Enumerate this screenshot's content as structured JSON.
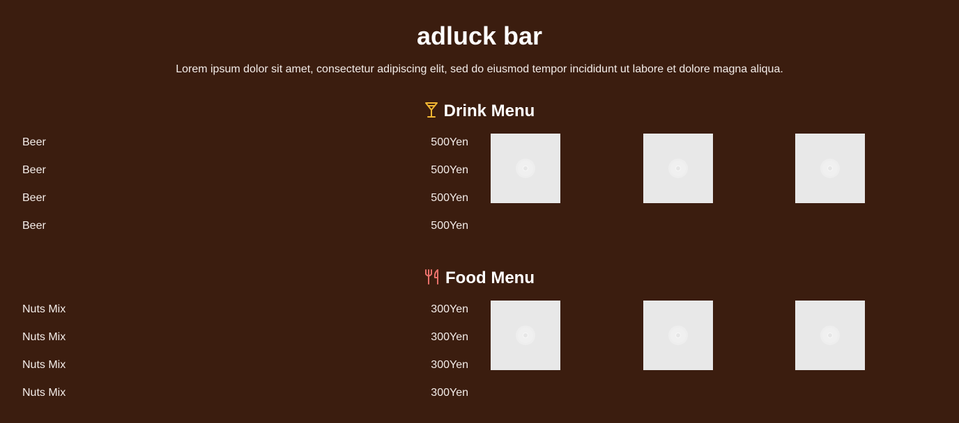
{
  "site": {
    "title": "adluck bar",
    "description": "Lorem ipsum dolor sit amet, consectetur adipiscing elit, sed do eiusmod tempor incididunt ut labore et dolore magna aliqua."
  },
  "drink_menu": {
    "heading": "Drink Menu",
    "icon": "cocktail-glass-icon",
    "icon_color": "#f2b632",
    "items": [
      {
        "name": "Beer",
        "price": "500Yen"
      },
      {
        "name": "Beer",
        "price": "500Yen"
      },
      {
        "name": "Beer",
        "price": "500Yen"
      },
      {
        "name": "Beer",
        "price": "500Yen"
      }
    ]
  },
  "food_menu": {
    "heading": "Food Menu",
    "icon": "fork-knife-icon",
    "icon_color": "#e8706a",
    "items": [
      {
        "name": "Nuts Mix",
        "price": "300Yen"
      },
      {
        "name": "Nuts Mix",
        "price": "300Yen"
      },
      {
        "name": "Nuts Mix",
        "price": "300Yen"
      },
      {
        "name": "Nuts Mix",
        "price": "300Yen"
      }
    ]
  },
  "colors": {
    "background": "#3b1d0f",
    "text": "#f3ece8",
    "image_placeholder": "#e8e8e8"
  }
}
